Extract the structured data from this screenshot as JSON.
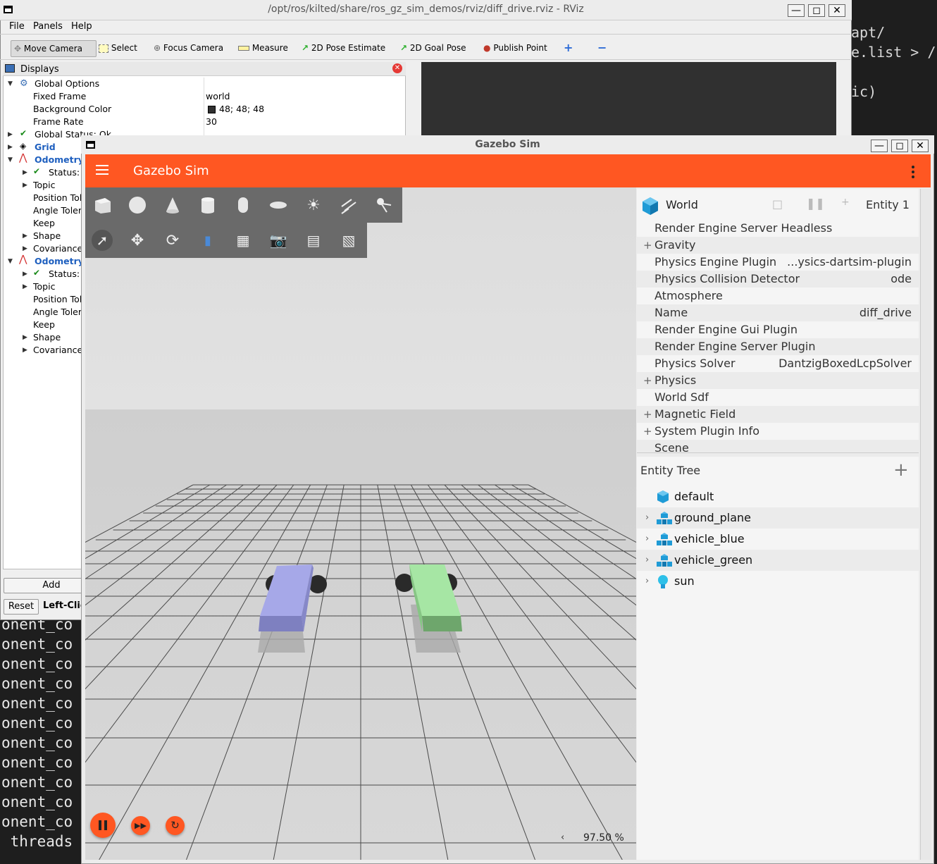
{
  "terminal": {
    "lines": [
      "onent_co",
      "onent_co",
      "onent_co",
      "onent_co",
      "onent_co",
      "onent_co",
      "onent_co",
      "onent_co",
      "onent_co",
      "onent_co",
      "onent_co"
    ],
    "last_line": " threads",
    "right_lines": [
      "apt/",
      "e.list > /",
      "ic)"
    ]
  },
  "rviz": {
    "title": "/opt/ros/kilted/share/ros_gz_sim_demos/rviz/diff_drive.rviz - RViz",
    "menu": [
      "File",
      "Panels",
      "Help"
    ],
    "toolbar": {
      "move_camera": "Move Camera",
      "select": "Select",
      "focus_camera": "Focus Camera",
      "measure": "Measure",
      "pose_estimate": "2D Pose Estimate",
      "goal_pose": "2D Goal Pose",
      "publish_point": "Publish Point"
    },
    "displays_title": "Displays",
    "tree": {
      "global_options": "Global Options",
      "fixed_frame": "Fixed Frame",
      "fixed_frame_val": "world",
      "bg_color": "Background Color",
      "bg_color_val": "48; 48; 48",
      "frame_rate": "Frame Rate",
      "frame_rate_val": "30",
      "global_status": "Global Status: Ok",
      "grid": "Grid",
      "odometry1": "Odometry",
      "odometry2": "Odometry",
      "status": "Status:",
      "topic": "Topic",
      "position_tol": "Position Tol",
      "angle_tol": "Angle Tolera",
      "keep": "Keep",
      "shape": "Shape",
      "covariance": "Covariance"
    },
    "add_button": "Add",
    "reset_button": "Reset",
    "hint": "Left-Clic"
  },
  "gazebo": {
    "window_title": "Gazebo Sim",
    "app_title": "Gazebo Sim",
    "world": {
      "label": "World",
      "entity": "Entity 1"
    },
    "properties": [
      {
        "label": "Render Engine Server Headless",
        "value": "",
        "plus": false
      },
      {
        "label": "Gravity",
        "value": "",
        "plus": true
      },
      {
        "label": "Physics Engine Plugin",
        "value": "...ysics-dartsim-plugin",
        "plus": false
      },
      {
        "label": "Physics Collision Detector",
        "value": "ode",
        "plus": false
      },
      {
        "label": "Atmosphere",
        "value": "",
        "plus": false
      },
      {
        "label": "Name",
        "value": "diff_drive",
        "plus": false
      },
      {
        "label": "Render Engine Gui Plugin",
        "value": "",
        "plus": false
      },
      {
        "label": "Render Engine Server Plugin",
        "value": "",
        "plus": false
      },
      {
        "label": "Physics Solver",
        "value": "DantzigBoxedLcpSolver",
        "plus": false
      },
      {
        "label": "Physics",
        "value": "",
        "plus": true
      },
      {
        "label": "World Sdf",
        "value": "",
        "plus": false
      },
      {
        "label": "Magnetic Field",
        "value": "",
        "plus": true
      },
      {
        "label": "System Plugin Info",
        "value": "",
        "plus": true
      },
      {
        "label": "Scene",
        "value": "",
        "plus": false
      }
    ],
    "entity_tree": {
      "title": "Entity Tree",
      "items": [
        {
          "label": "default",
          "icon": "cube-icon",
          "expandable": false
        },
        {
          "label": "ground_plane",
          "icon": "model-icon",
          "expandable": true
        },
        {
          "label": "vehicle_blue",
          "icon": "model-icon",
          "expandable": true
        },
        {
          "label": "vehicle_green",
          "icon": "model-icon",
          "expandable": true
        },
        {
          "label": "sun",
          "icon": "light-icon",
          "expandable": true
        }
      ]
    },
    "rtf": "97.50 %",
    "colors": {
      "accent": "#ff5722",
      "vehicle_blue": "#a6a8e8",
      "vehicle_green": "#a6e6a4"
    }
  }
}
